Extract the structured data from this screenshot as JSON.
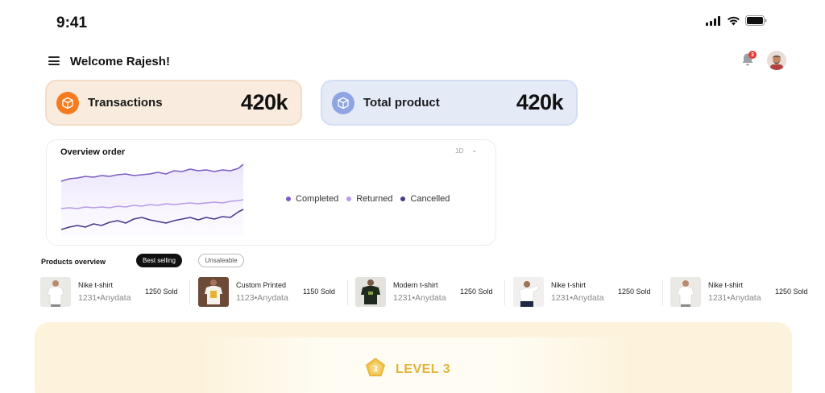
{
  "status_bar": {
    "time": "9:41",
    "icons": [
      "signal-icon",
      "wifi-icon",
      "battery-icon"
    ]
  },
  "header": {
    "welcome": "Welcome Rajesh!",
    "notification_count": "3"
  },
  "stats": [
    {
      "label": "Transactions",
      "value": "420k",
      "icon": "box-icon",
      "color": "#f47c1f"
    },
    {
      "label": "Total product",
      "value": "420k",
      "icon": "box-icon",
      "color": "#8ea4e3"
    }
  ],
  "overview": {
    "title": "Overview order",
    "range": "1D",
    "legend": [
      {
        "label": "Completed",
        "color": "#7c5cc4"
      },
      {
        "label": "Returned",
        "color": "#b79be8"
      },
      {
        "label": "Cancelled",
        "color": "#4a3a8c"
      }
    ]
  },
  "products_overview": {
    "title": "Products overview",
    "filters": [
      "Best selling",
      "Unsaleable"
    ],
    "active_filter": "Best selling",
    "items": [
      {
        "name": "Nike t-shirt",
        "sub": "1231•Anydata",
        "sold": "1250 Sold",
        "thumb": "white-tshirt"
      },
      {
        "name": "Custom Printed",
        "sub": "1123•Anydata",
        "sold": "1150 Sold",
        "thumb": "printed-tshirt"
      },
      {
        "name": "Modern t-shirt",
        "sub": "1231•Anydata",
        "sold": "1250 Sold",
        "thumb": "black-tshirt"
      },
      {
        "name": "Nike t-shirt",
        "sub": "1231•Anydata",
        "sold": "1250 Sold",
        "thumb": "white-tshirt"
      },
      {
        "name": "Nike t-shirt",
        "sub": "1231•Anydata",
        "sold": "1250 Sold",
        "thumb": "white-tshirt"
      }
    ]
  },
  "level": {
    "number": "3",
    "label": "LEVEL 3",
    "color": "#e0b33a"
  }
}
